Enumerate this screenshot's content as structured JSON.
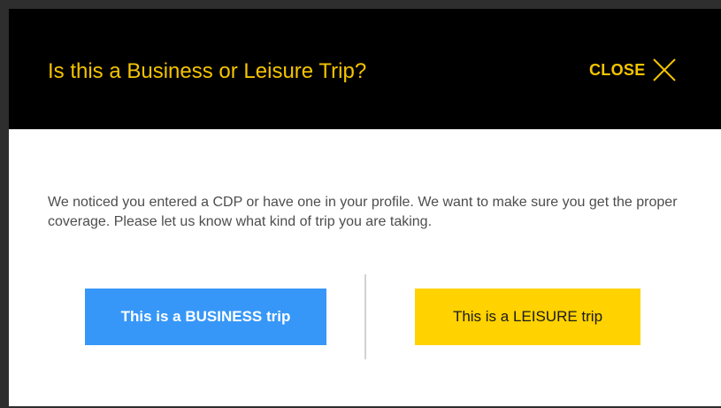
{
  "modal": {
    "title": "Is this a Business or Leisure Trip?",
    "close_label": "CLOSE",
    "close_icon": "close-icon",
    "message": "We noticed you entered a CDP or have one in your profile. We want to make sure you get the proper coverage. Please let us know what kind of trip you are taking.",
    "business_button": "This is a BUSINESS trip",
    "leisure_button": "This is a LEISURE trip"
  },
  "colors": {
    "header_bg": "#000000",
    "accent_yellow": "#f5c400",
    "business_blue": "#3797f8",
    "leisure_yellow": "#ffd200",
    "backdrop": "#2e2e2e"
  }
}
